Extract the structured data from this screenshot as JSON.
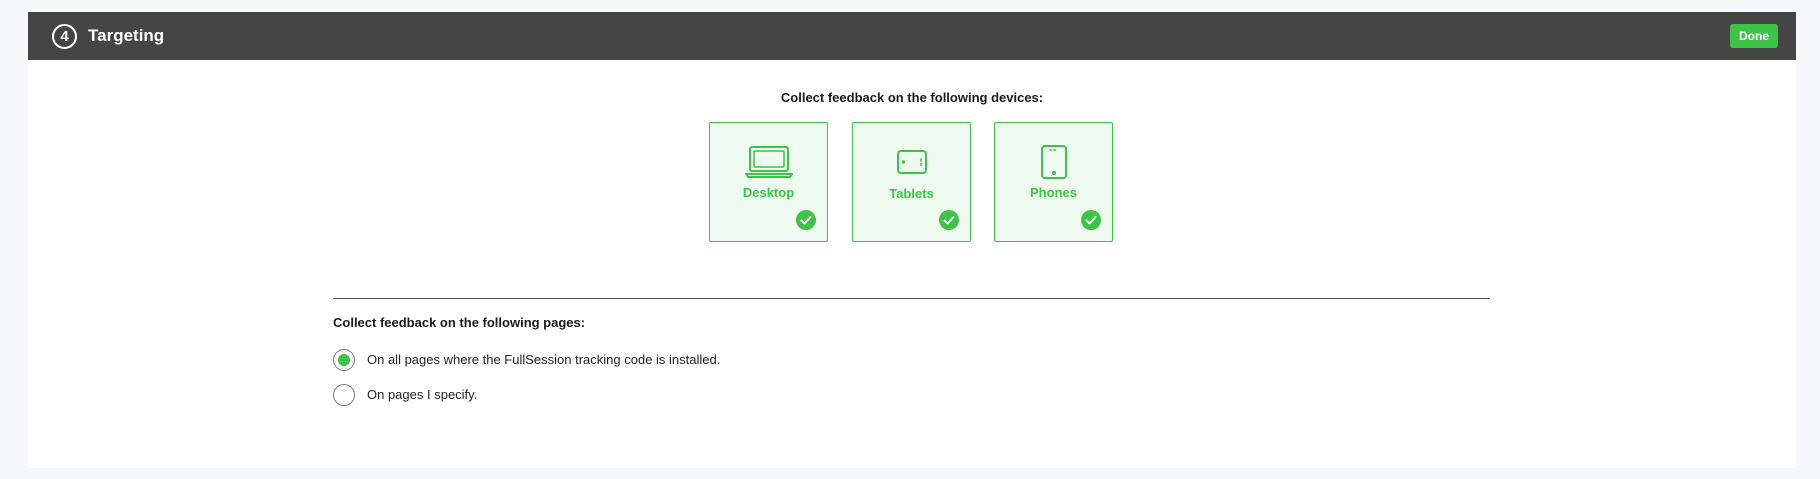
{
  "header": {
    "step_number": "4",
    "title": "Targeting",
    "done_label": "Done"
  },
  "devices": {
    "heading": "Collect feedback on the following devices:",
    "items": [
      {
        "label": "Desktop",
        "icon": "laptop-icon",
        "selected": true
      },
      {
        "label": "Tablets",
        "icon": "tablet-icon",
        "selected": true
      },
      {
        "label": "Phones",
        "icon": "phone-icon",
        "selected": true
      }
    ]
  },
  "pages": {
    "heading": "Collect feedback on the following pages:",
    "options": [
      {
        "label": "On all pages where the FullSession tracking code is installed.",
        "selected": true
      },
      {
        "label": "On pages I specify.",
        "selected": false
      }
    ]
  },
  "colors": {
    "accent": "#3cc348",
    "header_bg": "#454543",
    "card_bg": "#eef9ef"
  }
}
